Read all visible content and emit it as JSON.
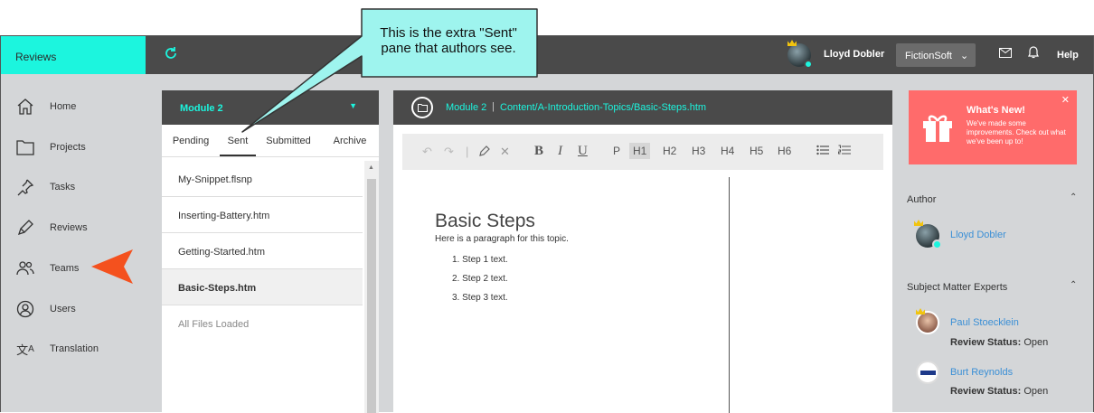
{
  "app": {
    "title": "Reviews"
  },
  "header": {
    "user_name": "Lloyd Dobler",
    "org": "FictionSoft",
    "help": "Help"
  },
  "sidebar": {
    "items": [
      {
        "label": "Home",
        "icon": "home-icon"
      },
      {
        "label": "Projects",
        "icon": "folder-icon"
      },
      {
        "label": "Tasks",
        "icon": "pin-icon"
      },
      {
        "label": "Reviews",
        "icon": "pencil-icon"
      },
      {
        "label": "Teams",
        "icon": "users-icon"
      },
      {
        "label": "Users",
        "icon": "user-circle-icon"
      },
      {
        "label": "Translation",
        "icon": "translate-icon"
      }
    ]
  },
  "files_panel": {
    "module": "Module 2",
    "tabs": [
      "Pending",
      "Sent",
      "Submitted",
      "Archive"
    ],
    "active_tab": "Sent",
    "files": [
      "My-Snippet.flsnp",
      "Inserting-Battery.htm",
      "Getting-Started.htm",
      "Basic-Steps.htm"
    ],
    "selected_file": "Basic-Steps.htm",
    "footer": "All Files Loaded"
  },
  "editor": {
    "breadcrumb_module": "Module 2",
    "breadcrumb_path": "Content/A-Introduction-Topics/Basic-Steps.htm",
    "toolbar": {
      "bold": "B",
      "italic": "I",
      "underline": "U",
      "p": "P",
      "h1": "H1",
      "h2": "H2",
      "h3": "H3",
      "h4": "H4",
      "h5": "H5",
      "h6": "H6"
    },
    "doc": {
      "heading": "Basic Steps",
      "paragraph": "Here is a paragraph for this topic.",
      "steps": [
        "1. Step 1 text.",
        "2. Step 2 text.",
        "3. Step 3 text."
      ]
    }
  },
  "whats_new": {
    "title": "What's New!",
    "body": "We've made some improvements. Check out what we've been up to!"
  },
  "author_section": {
    "title": "Author",
    "name": "Lloyd Dobler"
  },
  "sme_section": {
    "title": "Subject Matter Experts",
    "status_label": "Review Status:",
    "people": [
      {
        "name": "Paul Stoecklein",
        "status": "Open"
      },
      {
        "name": "Burt Reynolds",
        "status": "Open"
      }
    ]
  },
  "callout": {
    "text": "This is the extra \"Sent\" pane that authors see."
  },
  "colors": {
    "accent": "#1cf5de",
    "header": "#4a4a4a",
    "pointer": "#f4511e",
    "whats_new": "#ff6b6b",
    "callout": "#9ef4ee"
  }
}
